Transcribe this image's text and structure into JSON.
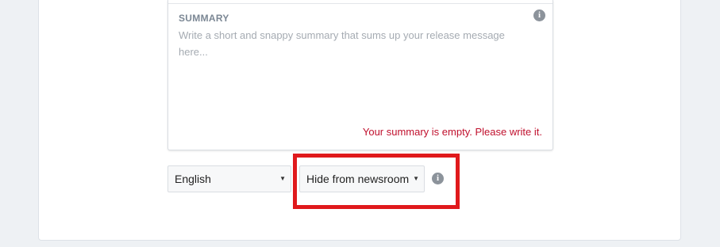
{
  "summary": {
    "label": "SUMMARY",
    "placeholder": "Write a short and snappy summary that sums up your release message here...",
    "value": "",
    "error": "Your summary is empty. Please write it."
  },
  "language_select": {
    "selected": "English"
  },
  "visibility_select": {
    "selected": "Hide from newsroom"
  },
  "icons": {
    "summary_info": "info-icon",
    "visibility_info": "info-icon",
    "dropdown": "caret-down-icon"
  },
  "colors": {
    "error": "#c0102d",
    "highlight": "#e0191c",
    "background": "#eef1f4"
  }
}
